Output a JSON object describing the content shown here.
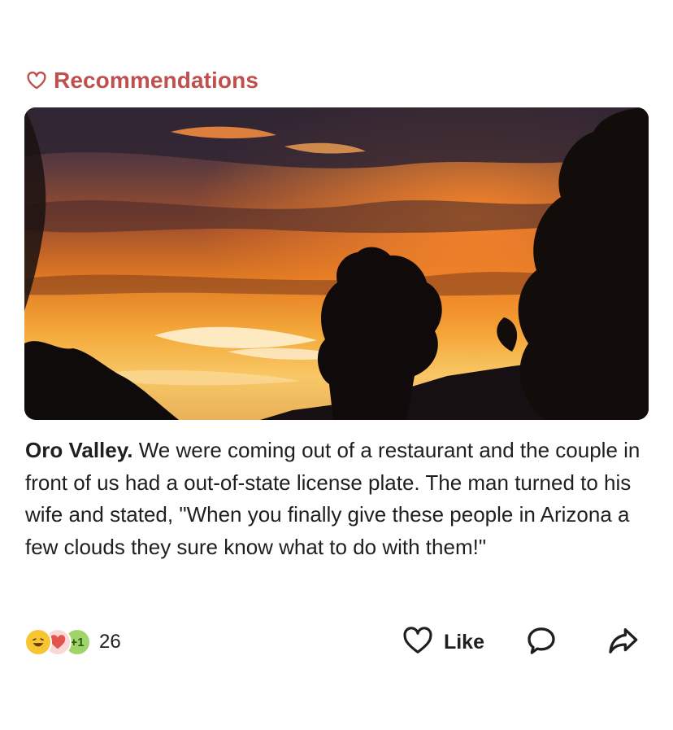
{
  "section": {
    "icon": "heart-outline-icon",
    "title": "Recommendations",
    "accent_color": "#c0504d"
  },
  "post": {
    "image": {
      "icon": "sunset-photo"
    },
    "place": "Oro Valley.",
    "body": " We were coming out of a restaurant and the couple in front of us had a out-of-state license plate. The man turned to his wife and stated, \"When you finally give these people in Arizona a few clouds they sure know what to do with them!\""
  },
  "footer": {
    "reactions": [
      {
        "name": "laugh",
        "icon": "laughing-face-icon"
      },
      {
        "name": "love",
        "icon": "heart-reaction-icon"
      },
      {
        "name": "plus",
        "label": "+1"
      }
    ],
    "reaction_count": "26",
    "like_label": "Like",
    "like_icon": "heart-outline-icon",
    "comment_icon": "speech-bubble-icon",
    "share_icon": "share-arrow-icon"
  }
}
